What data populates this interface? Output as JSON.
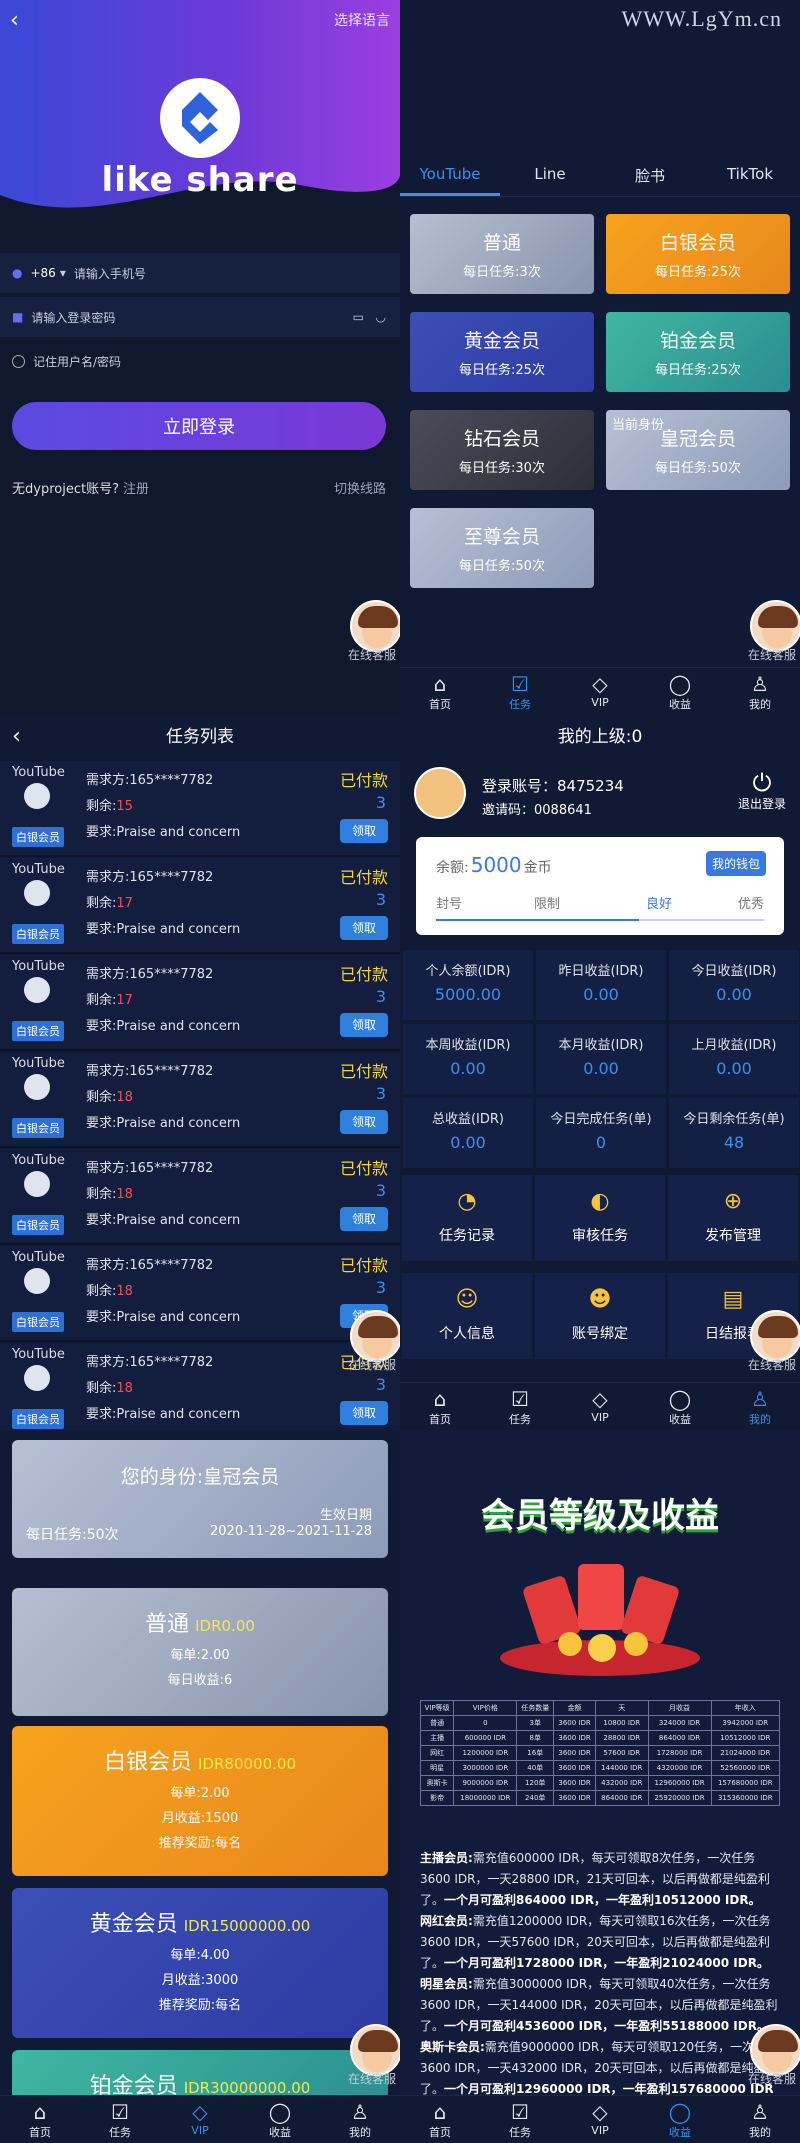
{
  "watermark": "WWW.LgYm.cn",
  "login": {
    "lang": "选择语言",
    "brand": "like share",
    "country_code": "+86",
    "phone_placeholder": "请输入手机号",
    "password_placeholder": "请输入登录密码",
    "remember": "记住用户名/密码",
    "login_button": "立即登录",
    "no_account": "无dyproject账号?",
    "register": "注册",
    "switch_line": "切换线路",
    "service": "在线客服"
  },
  "vip_grid": {
    "tabs": [
      "YouTube",
      "Line",
      "脸书",
      "TikTok"
    ],
    "active_tab": 0,
    "current_label": "当前身份",
    "cards": [
      {
        "name": "普通",
        "daily": "每日任务:3次"
      },
      {
        "name": "白银会员",
        "daily": "每日任务:25次"
      },
      {
        "name": "黄金会员",
        "daily": "每日任务:25次"
      },
      {
        "name": "铂金会员",
        "daily": "每日任务:25次"
      },
      {
        "name": "钻石会员",
        "daily": "每日任务:30次"
      },
      {
        "name": "皇冠会员",
        "daily": "每日任务:50次"
      },
      {
        "name": "至尊会员",
        "daily": "每日任务:50次"
      }
    ]
  },
  "nav": {
    "items": [
      "首页",
      "任务",
      "VIP",
      "收益",
      "我的"
    ]
  },
  "tasks": {
    "title": "任务列表",
    "items": [
      {
        "source": "YouTube",
        "level": "白银会员",
        "buyer": "需求方:165****7782",
        "left_label": "剩余:",
        "left": "15",
        "require": "要求:Praise and concern",
        "status": "已付款",
        "count": "3",
        "action": "领取"
      },
      {
        "source": "YouTube",
        "level": "白银会员",
        "buyer": "需求方:165****7782",
        "left_label": "剩余:",
        "left": "17",
        "require": "要求:Praise and concern",
        "status": "已付款",
        "count": "3",
        "action": "领取"
      },
      {
        "source": "YouTube",
        "level": "白银会员",
        "buyer": "需求方:165****7782",
        "left_label": "剩余:",
        "left": "17",
        "require": "要求:Praise and concern",
        "status": "已付款",
        "count": "3",
        "action": "领取"
      },
      {
        "source": "YouTube",
        "level": "白银会员",
        "buyer": "需求方:165****7782",
        "left_label": "剩余:",
        "left": "18",
        "require": "要求:Praise and concern",
        "status": "已付款",
        "count": "3",
        "action": "领取"
      },
      {
        "source": "YouTube",
        "level": "白银会员",
        "buyer": "需求方:165****7782",
        "left_label": "剩余:",
        "left": "18",
        "require": "要求:Praise and concern",
        "status": "已付款",
        "count": "3",
        "action": "领取"
      },
      {
        "source": "YouTube",
        "level": "白银会员",
        "buyer": "需求方:165****7782",
        "left_label": "剩余:",
        "left": "18",
        "require": "要求:Praise and concern",
        "status": "已付款",
        "count": "3",
        "action": "领取"
      },
      {
        "source": "YouTube",
        "level": "白银会员",
        "buyer": "需求方:165****7782",
        "left_label": "剩余:",
        "left": "18",
        "require": "要求:Praise and concern",
        "status": "已付款",
        "count": "3",
        "action": "领取"
      }
    ]
  },
  "profile": {
    "title": "我的上级:0",
    "account": "登录账号：8475234",
    "invite": "邀请码：0088641",
    "logout": "退出登录",
    "balance_label": "余额:",
    "balance": "5000",
    "balance_unit": "金币",
    "wallet_button": "我的钱包",
    "levels": [
      "封号",
      "限制",
      "良好",
      "优秀"
    ],
    "stats": [
      {
        "label": "个人余额(IDR)",
        "value": "5000.00"
      },
      {
        "label": "昨日收益(IDR)",
        "value": "0.00"
      },
      {
        "label": "今日收益(IDR)",
        "value": "0.00"
      },
      {
        "label": "本周收益(IDR)",
        "value": "0.00"
      },
      {
        "label": "本月收益(IDR)",
        "value": "0.00"
      },
      {
        "label": "上月收益(IDR)",
        "value": "0.00"
      },
      {
        "label": "总收益(IDR)",
        "value": "0.00"
      },
      {
        "label": "今日完成任务(单)",
        "value": "0"
      },
      {
        "label": "今日剩余任务(单)",
        "value": "48"
      }
    ],
    "functions": [
      "任务记录",
      "审核任务",
      "发布管理",
      "个人信息",
      "账号绑定",
      "日结报表"
    ]
  },
  "identity": {
    "title": "您的身份:皇冠会员",
    "daily": "每日任务:50次",
    "valid_label": "生效日期",
    "valid_range": "2020-11-28~2021-11-28",
    "tiers": [
      {
        "name": "普通",
        "price": "IDR0.00",
        "lines": [
          "每单:2.00",
          "每日收益:6"
        ]
      },
      {
        "name": "白银会员",
        "price": "IDR80000.00",
        "lines": [
          "每单:2.00",
          "月收益:1500",
          "推荐奖励:每名"
        ]
      },
      {
        "name": "黄金会员",
        "price": "IDR15000000.00",
        "lines": [
          "每单:4.00",
          "月收益:3000",
          "推荐奖励:每名"
        ]
      },
      {
        "name": "铂金会员",
        "price": "IDR30000000.00",
        "lines": []
      }
    ]
  },
  "benefit": {
    "title": "会员等级及收益",
    "headers": [
      "VIP等级",
      "VIP价格",
      "任务数量",
      "金额",
      "天",
      "月收益",
      "年收入"
    ],
    "rows": [
      [
        "普通",
        "0",
        "3单",
        "3600 IDR",
        "10800 IDR",
        "324000 IDR",
        "3942000 IDR"
      ],
      [
        "主播",
        "600000 IDR",
        "8单",
        "3600 IDR",
        "28800 IDR",
        "864000 IDR",
        "10512000 IDR"
      ],
      [
        "网红",
        "1200000 IDR",
        "16单",
        "3600 IDR",
        "57600 IDR",
        "1728000 IDR",
        "21024000 IDR"
      ],
      [
        "明星",
        "3000000 IDR",
        "40单",
        "3600 IDR",
        "144000 IDR",
        "4320000 IDR",
        "52560000 IDR"
      ],
      [
        "奥斯卡",
        "9000000 IDR",
        "120单",
        "3600 IDR",
        "432000 IDR",
        "12960000 IDR",
        "157680000 IDR"
      ],
      [
        "影帝",
        "18000000 IDR",
        "240单",
        "3600 IDR",
        "864000 IDR",
        "25920000 IDR",
        "315360000 IDR"
      ]
    ],
    "paragraphs": [
      {
        "head": "主播会员:",
        "body": "需充值600000 IDR，每天可领取8次任务，一次任务3600 IDR，一天28800 IDR，21天可回本，以后再做都是纯盈利了。",
        "tail": "一个月可盈利864000 IDR，一年盈利10512000 IDR。"
      },
      {
        "head": "网红会员:",
        "body": "需充值1200000 IDR，每天可领取16次任务，一次任务3600 IDR，一天57600 IDR，20天可回本，以后再做都是纯盈利了。",
        "tail": "一个月可盈利1728000 IDR，一年盈利21024000 IDR。"
      },
      {
        "head": "明星会员:",
        "body": "需充值3000000 IDR，每天可领取40次任务，一次任务3600 IDR，一天144000 IDR，20天可回本，以后再做都是纯盈利了。",
        "tail": "一个月可盈利4536000 IDR，一年盈利55188000 IDR。"
      },
      {
        "head": "奥斯卡会员:",
        "body": "需充值9000000 IDR，每天可领取120任务，一次任务3600 IDR，一天432000 IDR，20天可回本，以后再做都是纯盈利了。",
        "tail": "一个月可盈利12960000 IDR，一年盈利157680000 IDR"
      }
    ]
  },
  "colors": {
    "accent": "#3a8ff0",
    "paid": "#f7d333",
    "remain": "#f25050"
  }
}
